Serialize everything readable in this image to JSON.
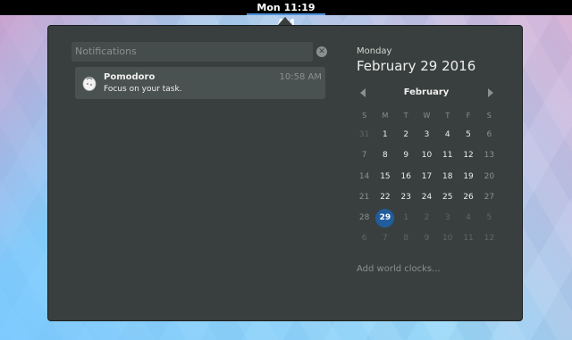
{
  "topbar": {
    "clock": "Mon 11:19 AM"
  },
  "notifications": {
    "header": "Notifications",
    "clear_icon": "close-circle-icon",
    "items": [
      {
        "icon": "pomodoro-icon",
        "title": "Pomodoro",
        "body": "Focus on your task.",
        "time": "10:58 AM"
      }
    ]
  },
  "calendar": {
    "weekday": "Monday",
    "date": "February 29 2016",
    "month": "February",
    "day_headers": [
      "S",
      "M",
      "T",
      "W",
      "T",
      "F",
      "S"
    ],
    "weeks": [
      [
        "31",
        "1",
        "2",
        "3",
        "4",
        "5",
        "6"
      ],
      [
        "7",
        "8",
        "9",
        "10",
        "11",
        "12",
        "13"
      ],
      [
        "14",
        "15",
        "16",
        "17",
        "18",
        "19",
        "20"
      ],
      [
        "21",
        "22",
        "23",
        "24",
        "25",
        "26",
        "27"
      ],
      [
        "28",
        "29",
        "1",
        "2",
        "3",
        "4",
        "5"
      ],
      [
        "6",
        "7",
        "8",
        "9",
        "10",
        "11",
        "12"
      ]
    ],
    "selected_day": "29",
    "world_clocks_link": "Add world clocks...",
    "accent_color": "#215d9c"
  }
}
